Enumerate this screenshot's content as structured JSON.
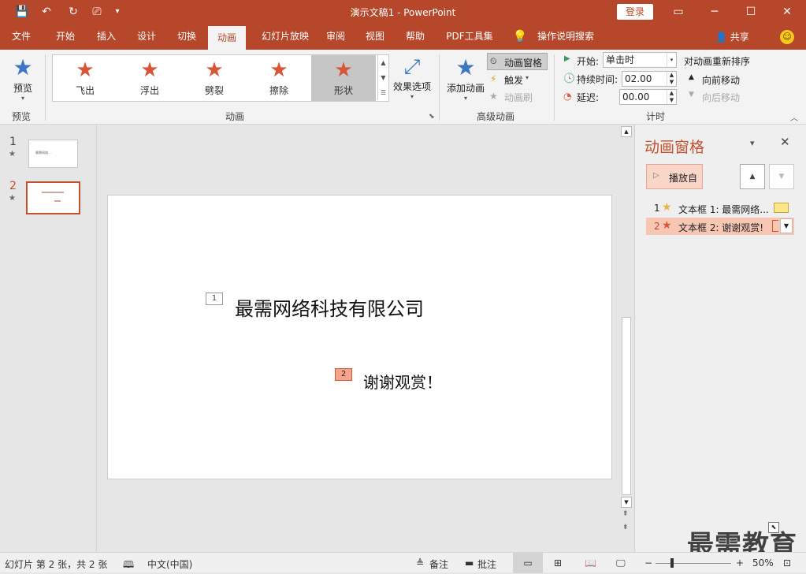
{
  "window": {
    "title": "演示文稿1  -  PowerPoint",
    "login_label": "登录",
    "controls": [
      "▭",
      "─",
      "☐",
      "✕"
    ]
  },
  "quick_access": {
    "save": "💾",
    "undo": "↶",
    "redo": "↻",
    "present": "⎚",
    "more": "▾"
  },
  "tabs": [
    "文件",
    "开始",
    "插入",
    "设计",
    "切换",
    "动画",
    "幻灯片放映",
    "审阅",
    "视图",
    "帮助",
    "PDF工具集",
    "操作说明搜索"
  ],
  "active_tab": "动画",
  "share_label": "共享",
  "ribbon": {
    "preview": {
      "label": "预览",
      "group": "预览"
    },
    "animations": {
      "group": "动画",
      "items": [
        "飞出",
        "浮出",
        "劈裂",
        "擦除",
        "形状"
      ],
      "selected": "形状",
      "effect_options": "效果选项"
    },
    "advanced": {
      "group": "高级动画",
      "add_animation": "添加动画",
      "animation_pane": "动画窗格",
      "trigger": "触发",
      "painter": "动画刷"
    },
    "timing": {
      "group": "计时",
      "start_label": "开始:",
      "start_value": "单击时",
      "duration_label": "持续时间:",
      "duration_value": "02.00",
      "delay_label": "延迟:",
      "delay_value": "00.00",
      "reorder_title": "对动画重新排序",
      "move_earlier": "向前移动",
      "move_later": "向后移动"
    }
  },
  "thumbnails": [
    {
      "num": "1",
      "star": "★",
      "text": "最需网络..."
    },
    {
      "num": "2",
      "star": "★",
      "text": "谢谢观赏"
    }
  ],
  "slide": {
    "tag1": "1",
    "title": "最需网络科技有限公司",
    "tag2": "2",
    "subtitle": "谢谢观赏！"
  },
  "anim_pane": {
    "title": "动画窗格",
    "play_label": "播放自",
    "items": [
      {
        "num": "1",
        "label": "文本框 1: 最需网络..."
      },
      {
        "num": "2",
        "label": "文本框 2: 谢谢观赏!"
      }
    ]
  },
  "status": {
    "slide_info": "幻灯片 第 2 张，共 2 张",
    "language": "中文(中国)",
    "notes": "备注",
    "comments": "批注",
    "zoom": "50%"
  },
  "watermark": "最需教育",
  "colors": {
    "accent": "#b7472a",
    "anim_star": "#d9553a",
    "selected_item": "#f8c7b4"
  }
}
